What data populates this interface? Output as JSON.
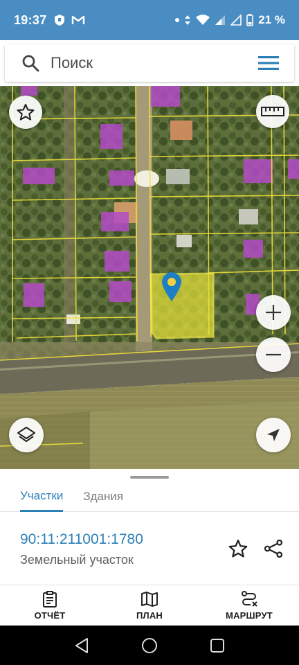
{
  "status_bar": {
    "time": "19:37",
    "battery_percent": "21 %",
    "icons": [
      "shield-notification-icon",
      "gmail-icon",
      "dot-icon",
      "data-arrows-icon",
      "wifi-icon",
      "signal-icon",
      "signal-empty-icon",
      "battery-icon"
    ]
  },
  "search": {
    "placeholder": "Поиск",
    "icon": "search-icon",
    "menu_icon": "hamburger-menu-icon"
  },
  "map": {
    "controls": {
      "favorite": "star-outline-icon",
      "ruler": "ruler-icon",
      "zoom_in": "plus-icon",
      "zoom_out": "minus-icon",
      "layers": "layers-icon",
      "locate": "navigation-arrow-icon"
    },
    "selected_marker": "map-pin-icon",
    "colors": {
      "parcel_outline": "#f2e23a",
      "selected_fill": "#e8e43a",
      "building_fill": "#b44bc8"
    }
  },
  "sheet": {
    "tabs": [
      {
        "label": "Участки",
        "active": true
      },
      {
        "label": "Здания",
        "active": false
      }
    ],
    "parcel_id": "90:11:211001:1780",
    "parcel_type": "Земельный участок",
    "actions": [
      "star-outline-icon",
      "share-icon"
    ]
  },
  "bottom_nav": {
    "items": [
      {
        "label": "ОТЧЁТ",
        "icon": "report-clipboard-icon"
      },
      {
        "label": "ПЛАН",
        "icon": "map-plan-icon"
      },
      {
        "label": "МАРШРУТ",
        "icon": "route-icon"
      }
    ]
  },
  "colors": {
    "accent": "#2d7fb7",
    "status_bar": "#4a8dc3"
  }
}
